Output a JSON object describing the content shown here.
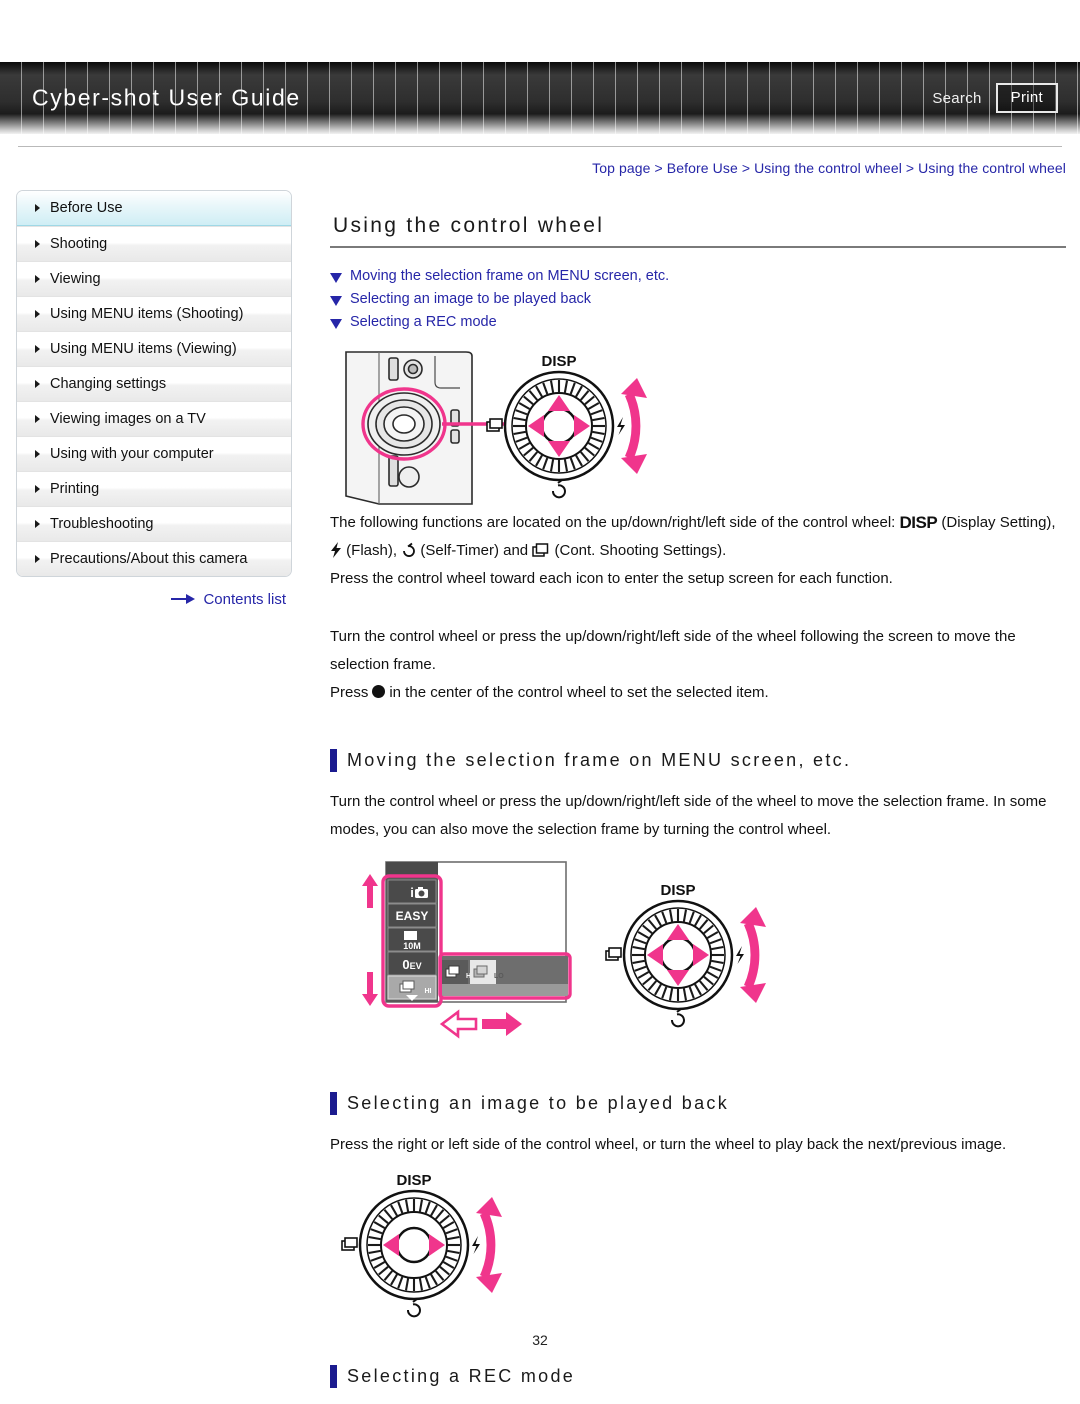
{
  "header": {
    "title": "Cyber-shot User Guide",
    "search_label": "Search",
    "print_label": "Print"
  },
  "sidebar": {
    "items": [
      {
        "label": "Before Use",
        "active": true
      },
      {
        "label": "Shooting",
        "active": false
      },
      {
        "label": "Viewing",
        "active": false
      },
      {
        "label": "Using MENU items (Shooting)",
        "active": false
      },
      {
        "label": "Using MENU items (Viewing)",
        "active": false
      },
      {
        "label": "Changing settings",
        "active": false
      },
      {
        "label": "Viewing images on a TV",
        "active": false
      },
      {
        "label": "Using with your computer",
        "active": false
      },
      {
        "label": "Printing",
        "active": false
      },
      {
        "label": "Troubleshooting",
        "active": false
      },
      {
        "label": "Precautions/About this camera",
        "active": false
      }
    ],
    "contents_link": "Contents list"
  },
  "main": {
    "breadcrumb": "Top page > Before Use > Using the control wheel > Using the control wheel",
    "page_title": "Using the control wheel",
    "jump_links": [
      "Moving the selection frame on MENU screen, etc.",
      "Selecting an image to be played back",
      "Selecting a REC mode"
    ],
    "intro": {
      "line1_a": "The following functions are located on the up/down/right/left side of the control wheel: ",
      "disp_glyph": "DISP",
      "line1_b": " (Display Setting), ",
      "line1_c": " (Flash), ",
      "line1_d": " (Self-Timer) and ",
      "line1_e": " (Cont. Shooting Settings).",
      "line2": "Press the control wheel toward each icon to enter the setup screen for each function.",
      "line3": "Turn the control wheel or press the up/down/right/left side of the wheel following the screen to move the selection frame.",
      "line4_a": "Press",
      "line4_b": "in the center of the control wheel to set the selected item."
    },
    "sections": [
      {
        "title": "Moving the selection frame on MENU screen, etc.",
        "body": "Turn the control wheel or press the up/down/right/left side of the wheel to move the selection frame. In some modes, you can also move the selection frame by turning the control wheel."
      },
      {
        "title": "Selecting an image to be played back",
        "body": "Press the right or left side of the control wheel, or turn the wheel to play back the next/previous image."
      },
      {
        "title": "Selecting a REC mode",
        "body": ""
      }
    ]
  },
  "figures": {
    "wheel_labels": {
      "disp": "DISP",
      "flash": "flash-icon",
      "self_timer": "self-timer-icon",
      "cont_shooting": "cont-shooting-icon"
    },
    "menu_items": [
      "iA",
      "EASY",
      "10M",
      "0EV",
      "BURST-HI"
    ],
    "menu_options": [
      "BURST-HI",
      "BURST-LO"
    ]
  },
  "page_number": "32",
  "colors": {
    "accent_pink": "#f0358c",
    "link_blue": "#2626a8",
    "heading_tick": "#1b1b8f",
    "header_dark": "#1a1a1a",
    "active_nav": "#cfeef5"
  }
}
